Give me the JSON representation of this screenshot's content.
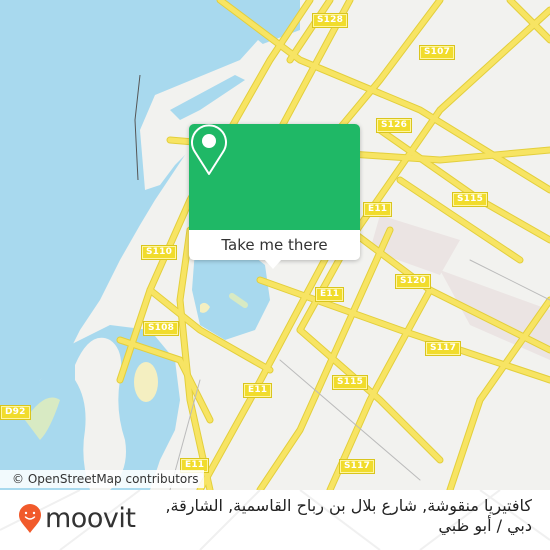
{
  "map": {
    "attribution": "© OpenStreetMap contributors",
    "road_labels": [
      "S128",
      "S107",
      "S126",
      "S115",
      "E11",
      "S120",
      "S110",
      "S108",
      "S117",
      "S115",
      "E11",
      "D92",
      "E11",
      "S117",
      "E11"
    ],
    "colors": {
      "water": "#a8d9ee",
      "land": "#f2f2ef",
      "road": "#f7e463",
      "road_casing": "#e3cf3c",
      "park": "#d8eac3",
      "industrial": "#ebe4e3",
      "shield": "#f1dc2c"
    }
  },
  "popup": {
    "button_label": "Take me there",
    "icon": "map-pin-icon",
    "color": "#1fb866"
  },
  "footer": {
    "brand": "moovit",
    "brand_color": "#f15a2b",
    "place_name": "كافتيريا منقوشة, شارع بلال بن رباح القاسمية, الشارقة, دبي / أبو ظبي"
  }
}
